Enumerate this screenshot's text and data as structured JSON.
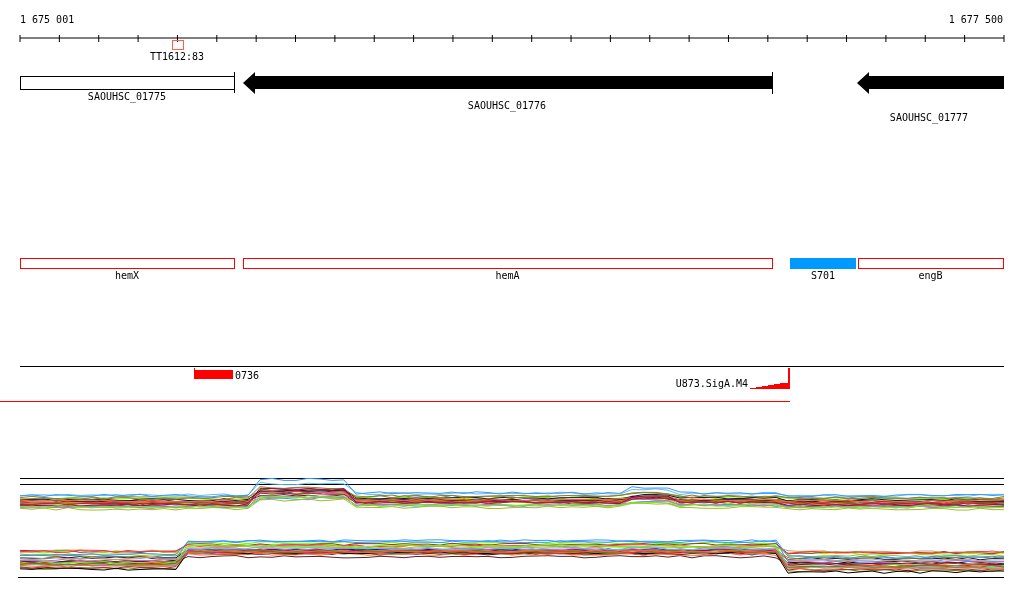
{
  "ruler": {
    "start_label": "1 675 001",
    "end_label": "1 677 500",
    "marker_label": "TT1612:83"
  },
  "genes": [
    {
      "name": "SAOUHSC_01775",
      "kind": "box"
    },
    {
      "name": "SAOUHSC_01776",
      "kind": "arrow"
    },
    {
      "name": "SAOUHSC_01777",
      "kind": "arrow"
    }
  ],
  "features": [
    {
      "name": "hemX",
      "kind": "outline",
      "color": "#ff0000"
    },
    {
      "name": "hemA",
      "kind": "outline",
      "color": "#ff0000"
    },
    {
      "name": "S701",
      "kind": "filled",
      "color": "#0099ff"
    },
    {
      "name": "engB",
      "kind": "outline",
      "color": "#ff0000"
    }
  ],
  "promoters": [
    {
      "name": "0736",
      "kind": "bar"
    },
    {
      "name": "U873.SigA.M4",
      "kind": "ramp"
    }
  ]
}
